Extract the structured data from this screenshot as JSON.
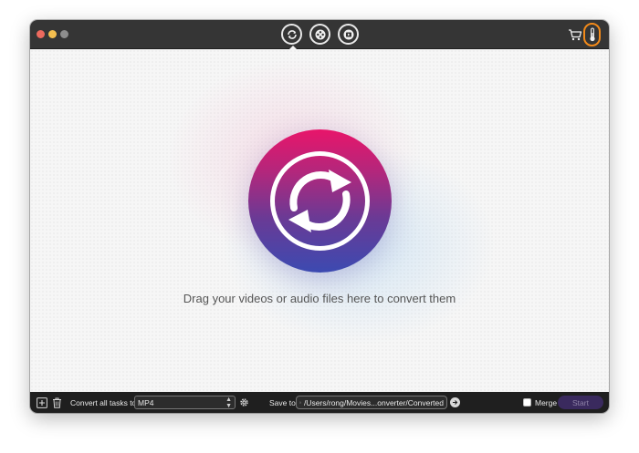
{
  "window": {
    "traffic_lights": [
      "close",
      "minimize",
      "zoom"
    ],
    "mode_tabs": [
      {
        "icon": "convert-icon",
        "active": true
      },
      {
        "icon": "video-reel-icon",
        "active": false
      },
      {
        "icon": "film-reel-icon",
        "active": false
      }
    ],
    "toolbar_icons": [
      "cart-icon",
      "thermometer-icon"
    ]
  },
  "main": {
    "drop_hint": "Drag your videos or audio files here to convert them",
    "center_icon": "convert-icon"
  },
  "bottom_bar": {
    "convert_all_label": "Convert all tasks to",
    "format_value": "MP4",
    "save_to_label": "Save to",
    "save_path": "/Users/rong/Movies...onverter/Converted",
    "merge_label": "Merge",
    "merge_checked": false,
    "start_label": "Start"
  },
  "colors": {
    "titlebar": "#353535",
    "highlight_ring": "#f28a1a",
    "gradient_top": "#e8156a",
    "gradient_bottom": "#3c4ab1",
    "start_button": "#3a2a5e"
  }
}
